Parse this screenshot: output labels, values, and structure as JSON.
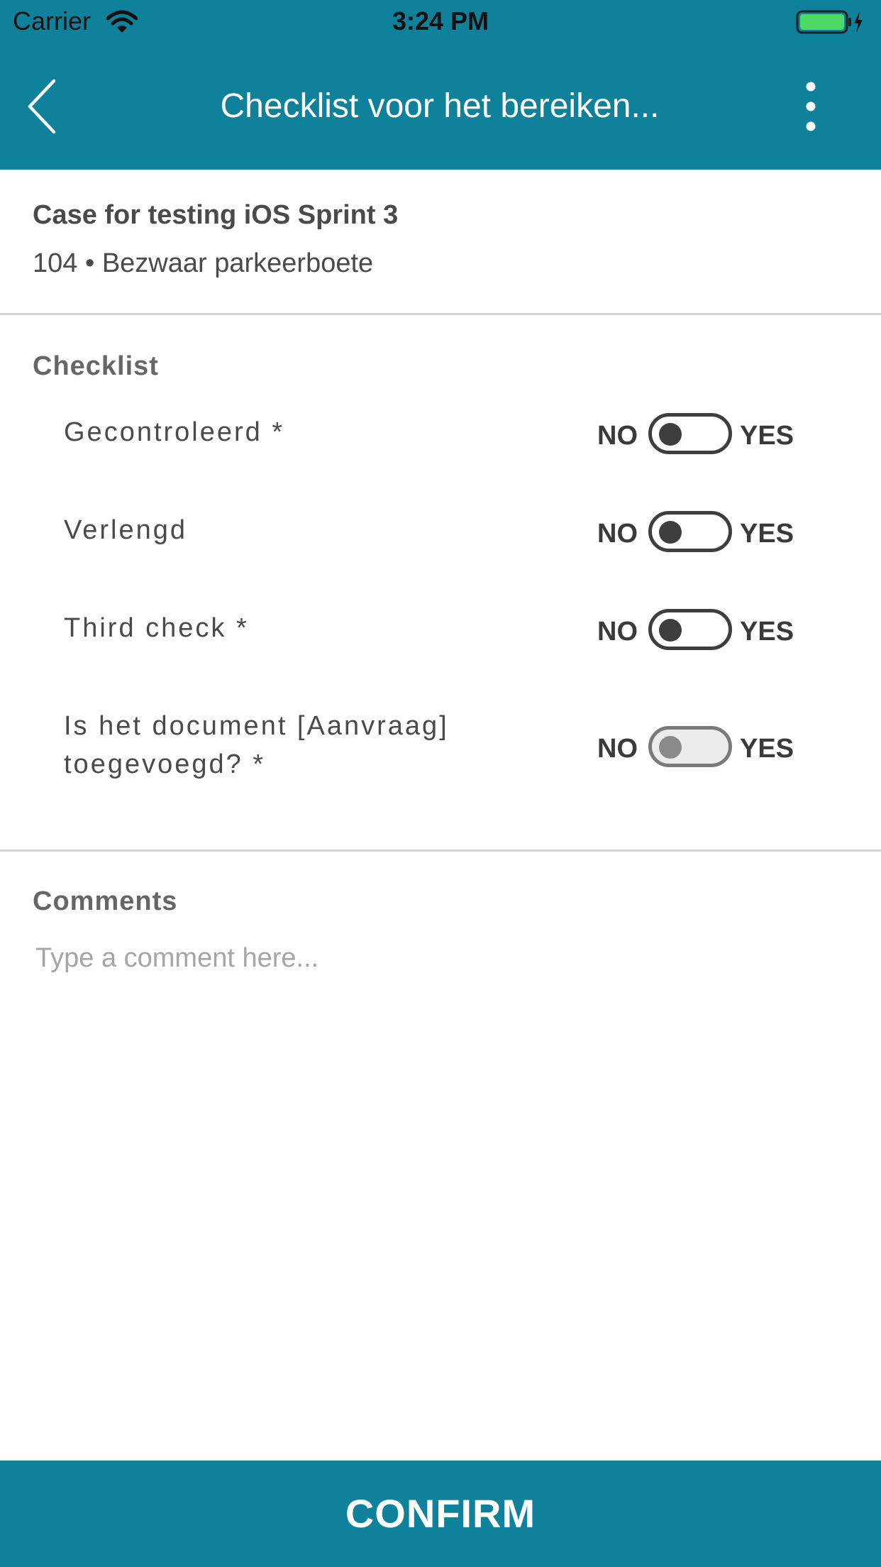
{
  "status_bar": {
    "carrier": "Carrier",
    "time": "3:24 PM",
    "wifi_icon": "wifi-icon",
    "battery_icon": "battery-charging-icon",
    "battery_color": "#4cd964"
  },
  "header": {
    "title": "Checklist voor het bereiken...",
    "back_icon": "chevron-left-icon",
    "menu_icon": "more-vertical-icon",
    "background_color": "#10819b"
  },
  "case": {
    "title": "Case for testing iOS Sprint 3",
    "subtitle": "104 • Bezwaar parkeerboete"
  },
  "checklist": {
    "heading": "Checklist",
    "no_label": "NO",
    "yes_label": "YES",
    "items": [
      {
        "label": "Gecontroleerd *",
        "value": "NO",
        "enabled": true
      },
      {
        "label": "Verlengd",
        "value": "NO",
        "enabled": true
      },
      {
        "label": "Third check *",
        "value": "NO",
        "enabled": true
      },
      {
        "label": "Is het document [Aanvraag] toegevoegd? *",
        "value": "NO",
        "enabled": false
      }
    ]
  },
  "comments": {
    "heading": "Comments",
    "placeholder": "Type a comment here...",
    "value": ""
  },
  "confirm_button": {
    "label": "CONFIRM",
    "color": "#10819b"
  }
}
